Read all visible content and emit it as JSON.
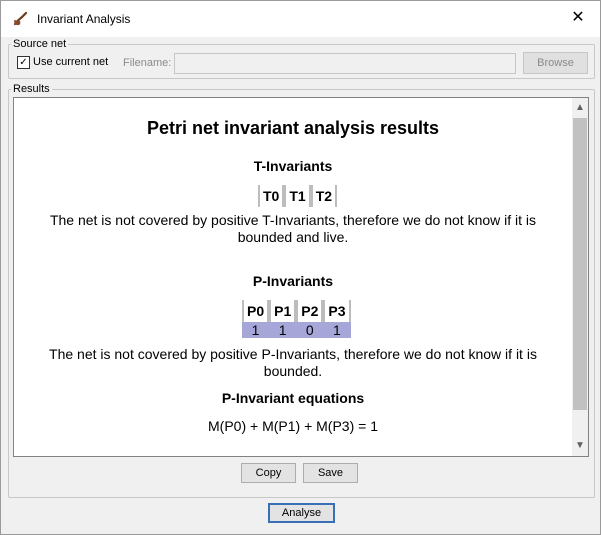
{
  "window": {
    "title": "Invariant Analysis",
    "close_glyph": "✕"
  },
  "source_net": {
    "legend": "Source net",
    "use_current_checked": true,
    "use_current_label": "Use current net",
    "filename_label": "Filename:",
    "filename_value": "",
    "browse_label": "Browse"
  },
  "results": {
    "legend": "Results",
    "heading": "Petri net invariant analysis results",
    "t_section": {
      "title": "T-Invariants",
      "columns": [
        "T0",
        "T1",
        "T2"
      ],
      "message": "The net is not covered by positive T-Invariants, therefore we do not know if it is bounded and live."
    },
    "p_section": {
      "title": "P-Invariants",
      "columns": [
        "P0",
        "P1",
        "P2",
        "P3"
      ],
      "values": [
        "1",
        "1",
        "0",
        "1"
      ],
      "message": "The net is not covered by positive P-Invariants, therefore we do not know if it is bounded."
    },
    "equations": {
      "title": "P-Invariant equations",
      "equation": "M(P0) + M(P1) + M(P3) = 1"
    }
  },
  "buttons": {
    "copy": "Copy",
    "save": "Save",
    "analyse": "Analyse"
  }
}
